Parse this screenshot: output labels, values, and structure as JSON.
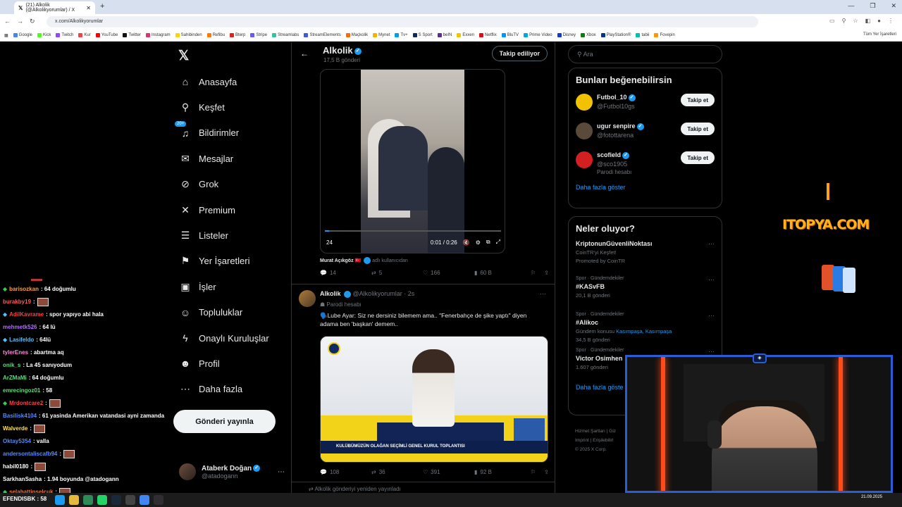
{
  "browser": {
    "tab_title": "(21) Alkolik (@Alkolikyorumlar) / X",
    "url": "x.com/Alkolikyorumlar",
    "bookmarks": [
      "Google",
      "Kick",
      "Twitch",
      "Kur",
      "YouTube",
      "Twitter",
      "Instagram",
      "Sahibinden",
      "Refibu",
      "Bterp",
      "Stripe",
      "Streamlabs",
      "StreamElements",
      "Maçkolik",
      "Mynet",
      "Tv+",
      "S Sport",
      "beIN",
      "Exxen",
      "Netflix",
      "BluTV",
      "Prime Video",
      "Disney",
      "Xbox",
      "PlayStation®",
      "tabii",
      "Fovepin"
    ],
    "bookmarks_right": "Tüm Yer İşaretleri"
  },
  "nav": {
    "notif_badge": "20+",
    "items": [
      {
        "label": "Anasayfa",
        "icon": "home-icon",
        "glyph": "⌂"
      },
      {
        "label": "Keşfet",
        "icon": "search-icon",
        "glyph": "⚲"
      },
      {
        "label": "Bildirimler",
        "icon": "bell-icon",
        "glyph": "♫"
      },
      {
        "label": "Mesajlar",
        "icon": "mail-icon",
        "glyph": "✉"
      },
      {
        "label": "Grok",
        "icon": "grok-icon",
        "glyph": "⊘"
      },
      {
        "label": "Premium",
        "icon": "x-icon",
        "glyph": "✕"
      },
      {
        "label": "Listeler",
        "icon": "list-icon",
        "glyph": "☰"
      },
      {
        "label": "Yer İşaretleri",
        "icon": "bookmark-icon",
        "glyph": "⚑"
      },
      {
        "label": "İşler",
        "icon": "briefcase-icon",
        "glyph": "▣"
      },
      {
        "label": "Topluluklar",
        "icon": "community-icon",
        "glyph": "☺"
      },
      {
        "label": "Onaylı Kuruluşlar",
        "icon": "lightning-icon",
        "glyph": "ϟ"
      },
      {
        "label": "Profil",
        "icon": "profile-icon",
        "glyph": "☻"
      },
      {
        "label": "Daha fazla",
        "icon": "more-circle-icon",
        "glyph": "⋯"
      }
    ],
    "post_button": "Gönderi yayınla",
    "me": {
      "name": "Ataberk Doğan",
      "handle": "@atadogann",
      "more": "⋯"
    }
  },
  "header": {
    "name": "Alkolik",
    "count": "17,5 B gönderi",
    "follow_button": "Takip ediliyor"
  },
  "tweet1": {
    "video_time": "0:01 / 0:26",
    "video_left": "24",
    "tagged_name": "Murat Açıkgöz 🇹🇷",
    "tagged_suffix": "adlı kullanıcıdan",
    "replies": "14",
    "retweets": "5",
    "likes": "166",
    "views": "60 B"
  },
  "tweet2": {
    "name": "Alkolik",
    "handle_time": "@Alkolikyorumlar · 2s",
    "parody": "Parodi hesabı",
    "text": "🗣️Lube Ayar: Siz ne dersiniz bilemem ama.. \"Fenerbahçe de şike yaptı\" diyen adama ben 'başkan' demem..",
    "video_banner": "KULÜBÜMÜZÜN OLAĞAN SEÇİMLİ GENEL KURUL TOPLANTISI",
    "replies": "108",
    "retweets": "36",
    "likes": "391",
    "views": "92 B",
    "repost_note": "Alkolik gönderiyi yeniden yayınladı"
  },
  "right": {
    "search_placeholder": "Ara",
    "wtf_title": "Bunları beğenebilirsin",
    "wtf": [
      {
        "name": "Futbol_10",
        "handle": "@Futbol10gs",
        "button": "Takip et",
        "color": "#f2c200",
        "parody": ""
      },
      {
        "name": "ugur senpire",
        "handle": "@fotottarena",
        "button": "Takip et",
        "color": "#5a4a3a",
        "parody": ""
      },
      {
        "name": "scofield",
        "handle": "@sco1905",
        "button": "Takip et",
        "color": "#d21f1f",
        "parody": "Parodi hesabı"
      }
    ],
    "show_more": "Daha fazla göster",
    "trends_title": "Neler oluyor?",
    "trends": [
      {
        "cat": "",
        "title": "KriptonunGüvenliNoktası",
        "sub": "CoinTR'yi Keşfet!",
        "extra": "Promoted by CoinTR"
      },
      {
        "cat": "Spor · Gündemdekiler",
        "title": "#KASvFB",
        "sub": "20,1 B gönderi",
        "extra": ""
      },
      {
        "cat": "Spor · Gündemdekiler",
        "title": "#Alikoc",
        "sub": "Gündem konusu",
        "links": "Kasımpaşa, Kasımpaşa",
        "extra": "34,5 B gönderi"
      },
      {
        "cat": "Spor · Gündemdekiler",
        "title": "Victor Osimhen",
        "sub": "1.607 gönderi",
        "extra": ""
      }
    ],
    "show_more2": "Daha fazla göste",
    "footer": [
      "Hizmet Şartları | Giz",
      "Imprint | Erişilebilirl",
      "© 2025 X Corp."
    ]
  },
  "ad": {
    "logo": "ITOPYA.COM"
  },
  "chat": [
    {
      "user": "barisozkan",
      "msg": ": 64 doğumlu",
      "color": "#ff9d3a",
      "dia": true
    },
    {
      "user": "burakby19",
      "msg": ":",
      "color": "#ff5a5a",
      "emo": true
    },
    {
      "user": "AdilKavrame",
      "msg": ": spor yapıyo abi hala",
      "color": "#ff4040",
      "badges": true
    },
    {
      "user": "mehmetk526",
      "msg": ": 64 lü",
      "color": "#b36bff"
    },
    {
      "user": "Lasifeldo",
      "msg": ": 64lü",
      "color": "#4fc3ff",
      "badges": true
    },
    {
      "user": "tylerEnes",
      "msg": ": abartma aq",
      "color": "#ff8ad8"
    },
    {
      "user": "onik_s",
      "msg": ": La 45 sanıyodum",
      "color": "#55e07a"
    },
    {
      "user": "ArZMaMi",
      "msg": ": 64 doğumlu",
      "color": "#55e07a"
    },
    {
      "user": "emrecingoz01",
      "msg": ": 58",
      "color": "#55e07a"
    },
    {
      "user": "Mrdontcare2",
      "msg": ":",
      "color": "#ff4040",
      "dia": true,
      "emo": true
    },
    {
      "user": "Basilisk4104",
      "msg": ": 61 yasinda Amerikan vatandasi ayni zamanda",
      "color": "#4f8cff"
    },
    {
      "user": "Walverde",
      "msg": ":",
      "color": "#ffe14a",
      "emo": true
    },
    {
      "user": "Oktay5354",
      "msg": ": valla",
      "color": "#4f8cff"
    },
    {
      "user": "andersontaliscafb94",
      "msg": ":",
      "color": "#4f8cff",
      "emo": true
    },
    {
      "user": "habil0180",
      "msg": ":",
      "color": "#fff",
      "emo": true
    },
    {
      "user": "SarkhanSasha",
      "msg": ": 1.94 boyunda @atadogann",
      "color": "#fff"
    },
    {
      "user": "selahattinselcuk",
      "msg": ":",
      "color": "#ff6a2a",
      "dia": true,
      "emo": true
    }
  ],
  "taskbar": {
    "left": "EFENDISBK : 58",
    "clock": "21.09.2025"
  }
}
